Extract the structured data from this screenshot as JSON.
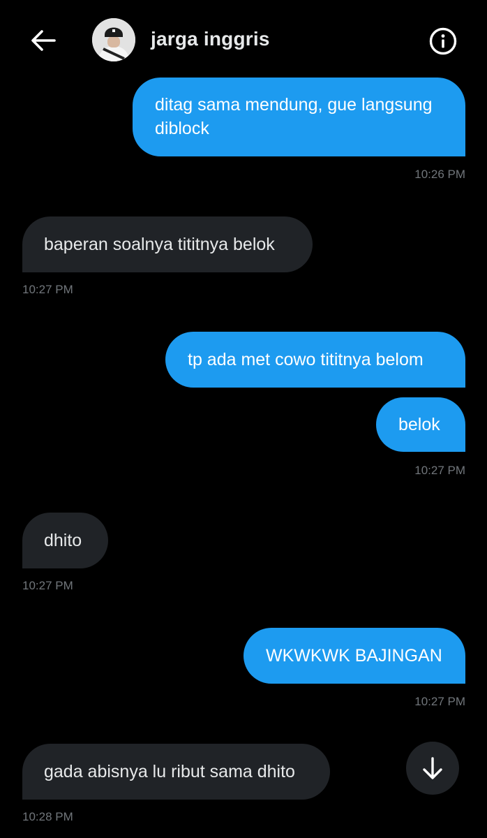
{
  "header": {
    "back_icon": "arrow-left-icon",
    "contact_name": "jarga inggris",
    "info_icon": "info-circle-icon"
  },
  "messages": [
    {
      "direction": "sent",
      "text": "ditag sama mendung, gue langsung diblock",
      "time": "10:26 PM"
    },
    {
      "direction": "received",
      "text": "baperan soalnya tititnya belok",
      "time": "10:27 PM"
    },
    {
      "direction": "sent",
      "text": "tp ada met cowo tititnya belom"
    },
    {
      "direction": "sent",
      "text": "belok",
      "time": "10:27 PM"
    },
    {
      "direction": "received",
      "text": "dhito",
      "time": "10:27 PM"
    },
    {
      "direction": "sent",
      "text": "WKWKWK BAJINGAN",
      "time": "10:27 PM"
    },
    {
      "direction": "received",
      "text": "gada abisnya lu ribut sama dhito",
      "time": "10:28 PM"
    }
  ],
  "scroll_button": {
    "icon": "arrow-down-icon"
  },
  "colors": {
    "background": "#000000",
    "sent_bubble": "#1d9bf0",
    "received_bubble": "#202327",
    "timestamp": "#71767b"
  }
}
